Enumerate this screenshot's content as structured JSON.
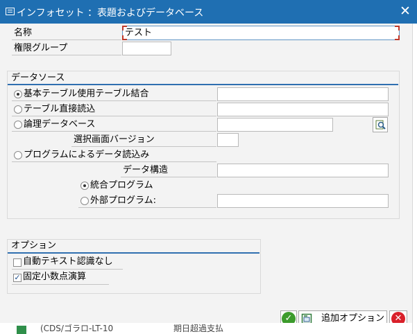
{
  "title": "インフォセット ：表題およびデータベース",
  "header": {
    "name_label": "名称",
    "name_value": "テスト",
    "group_label": "権限グループ",
    "group_value": ""
  },
  "datasource": {
    "title": "データソース",
    "options": [
      {
        "label": "基本テーブル使用テーブル結合",
        "selected": true
      },
      {
        "label": "テーブル直接読込",
        "selected": false
      },
      {
        "label": "論理データベース",
        "selected": false
      },
      {
        "label": "プログラムによるデータ読込み",
        "selected": false
      }
    ],
    "screen_version_label": "選択画面バージョン",
    "data_structure_label": "データ構造",
    "program_options": [
      {
        "label": "統合プログラム",
        "selected": true
      },
      {
        "label": "外部プログラム:",
        "selected": false
      }
    ]
  },
  "options": {
    "title": "オプション",
    "items": [
      {
        "label": "自動テキスト認識なし",
        "checked": false
      },
      {
        "label": "固定小数点演算",
        "checked": true
      }
    ]
  },
  "footer": {
    "add_options_label": "追加オプション"
  },
  "background_text": "(CDS/ゴラロ-LT-10",
  "background_text2": "期日超過支払"
}
